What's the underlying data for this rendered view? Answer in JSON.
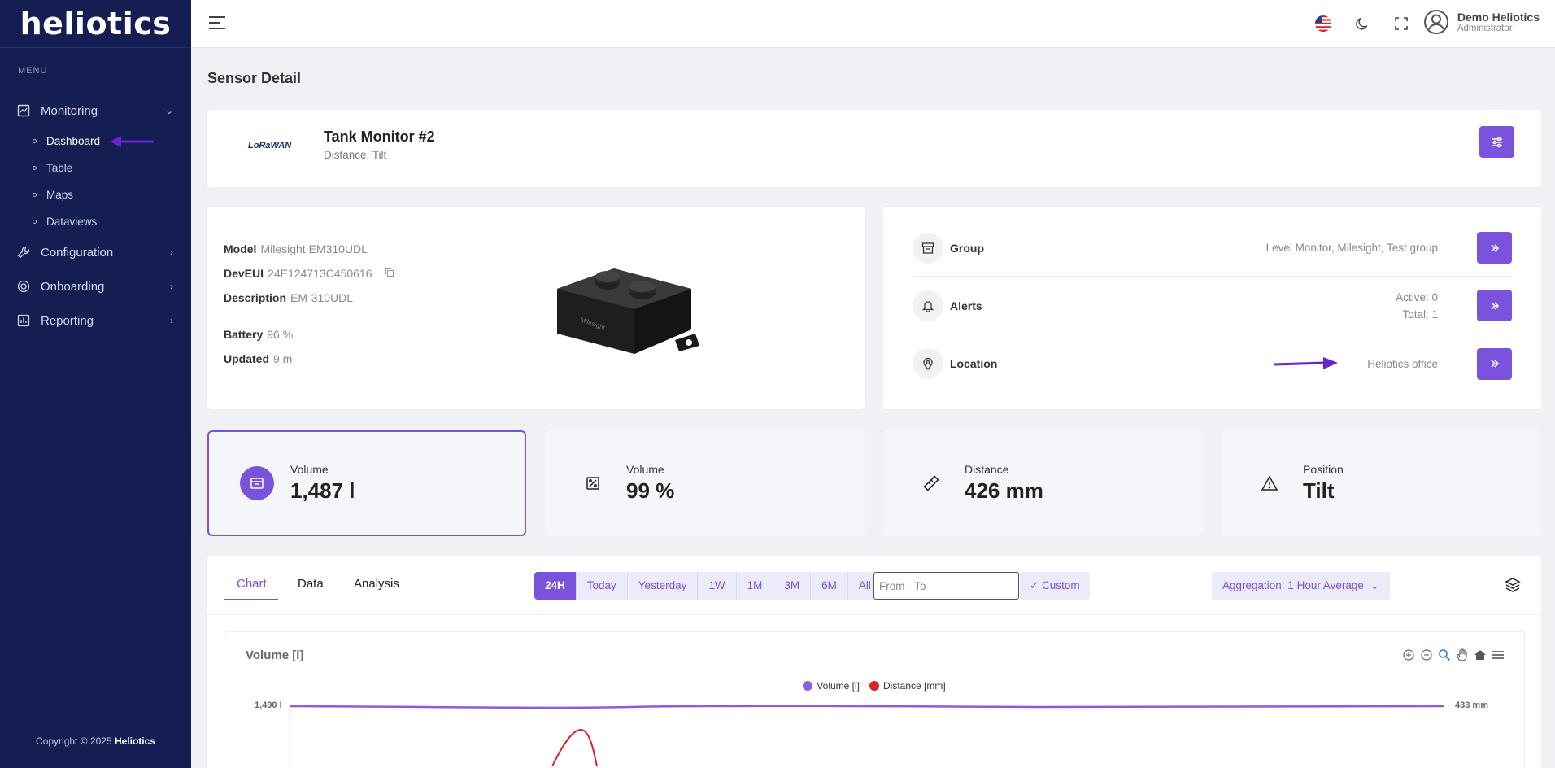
{
  "app": {
    "brand": "heliotics"
  },
  "sidebar": {
    "menu_title": "MENU",
    "items": [
      {
        "label": "Monitoring",
        "icon": "monitoring-icon",
        "expanded": true,
        "children": [
          {
            "label": "Dashboard"
          },
          {
            "label": "Table"
          },
          {
            "label": "Maps"
          },
          {
            "label": "Dataviews"
          }
        ]
      },
      {
        "label": "Configuration",
        "icon": "wrench-icon"
      },
      {
        "label": "Onboarding",
        "icon": "onboarding-icon"
      },
      {
        "label": "Reporting",
        "icon": "reporting-icon"
      }
    ],
    "copyright_prefix": "Copyright © 2025",
    "copyright_brand": "Heliotics"
  },
  "topbar": {
    "user_name": "Demo Heliotics",
    "user_role": "Administrator"
  },
  "page": {
    "title": "Sensor Detail"
  },
  "sensor": {
    "logo_text": "LoRaWAN",
    "name": "Tank Monitor #2",
    "types": "Distance, Tilt"
  },
  "details": {
    "model_label": "Model",
    "model_value": "Milesight EM310UDL",
    "deveui_label": "DevEUI",
    "deveui_value": "24E124713C450616",
    "description_label": "Description",
    "description_value": "EM-310UDL",
    "battery_label": "Battery",
    "battery_value": "96 %",
    "updated_label": "Updated",
    "updated_value": "9 m",
    "device_brand": "Milesight"
  },
  "meta": {
    "group_label": "Group",
    "group_value": "Level Monitor, Milesight, Test group",
    "alerts_label": "Alerts",
    "alerts_active": "Active: 0",
    "alerts_total": "Total: 1",
    "location_label": "Location",
    "location_value": "Heliotics office"
  },
  "stats": [
    {
      "label": "Volume",
      "value": "1,487 l",
      "icon": "box-icon"
    },
    {
      "label": "Volume",
      "value": "99 %",
      "icon": "percent-icon"
    },
    {
      "label": "Distance",
      "value": "426 mm",
      "icon": "ruler-icon"
    },
    {
      "label": "Position",
      "value": "Tilt",
      "icon": "warning-icon"
    }
  ],
  "tabs": [
    {
      "label": "Chart"
    },
    {
      "label": "Data"
    },
    {
      "label": "Analysis"
    }
  ],
  "ranges": [
    "24H",
    "Today",
    "Yesterday",
    "1W",
    "1M",
    "3M",
    "6M",
    "All"
  ],
  "date_placeholder": "From - To",
  "custom_label": "✓ Custom",
  "aggregation_label": "Aggregation: 1 Hour Average",
  "colors": {
    "accent": "#7b52dc",
    "sidebar": "#141e52",
    "series_volume": "#8a5ee0",
    "series_distance": "#d9242b"
  },
  "chart_data": {
    "type": "line",
    "title": "Volume [l]",
    "series": [
      {
        "name": "Volume [l]",
        "color": "#8a5ee0"
      },
      {
        "name": "Distance [mm]",
        "color": "#d9242b"
      }
    ],
    "y_left_tick": "1,490 l",
    "y_right_tick": "433 mm"
  }
}
